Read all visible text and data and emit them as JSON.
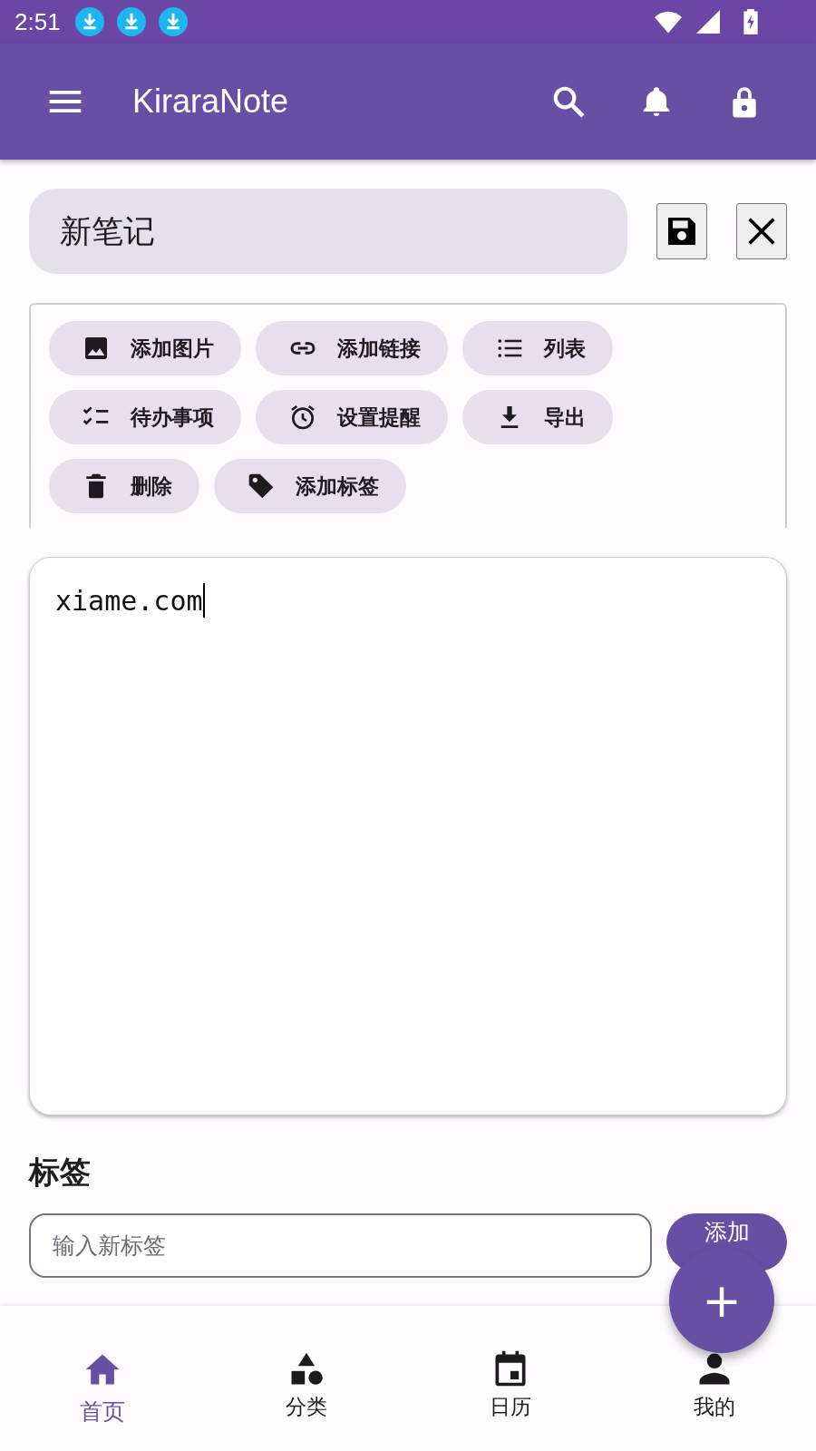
{
  "status_bar": {
    "time": "2:51"
  },
  "app_bar": {
    "title": "KiraraNote"
  },
  "note": {
    "title": "新笔记",
    "body": "xiame.com"
  },
  "toolbar": [
    {
      "kind": "image",
      "label": "添加图片"
    },
    {
      "kind": "link",
      "label": "添加链接"
    },
    {
      "kind": "list",
      "label": "列表"
    },
    {
      "kind": "checklist",
      "label": "待办事项"
    },
    {
      "kind": "alarm",
      "label": "设置提醒"
    },
    {
      "kind": "download",
      "label": "导出"
    },
    {
      "kind": "trash",
      "label": "删除"
    },
    {
      "kind": "tag",
      "label": "添加标签"
    }
  ],
  "tags": {
    "heading": "标签",
    "placeholder": "输入新标签",
    "add_button": "添加"
  },
  "fab": {
    "label": "+"
  },
  "bottom_nav": [
    {
      "kind": "home",
      "label": "首页",
      "selected": true
    },
    {
      "kind": "category",
      "label": "分类",
      "selected": false
    },
    {
      "kind": "calendar",
      "label": "日历",
      "selected": false
    },
    {
      "kind": "person",
      "label": "我的",
      "selected": false
    }
  ]
}
